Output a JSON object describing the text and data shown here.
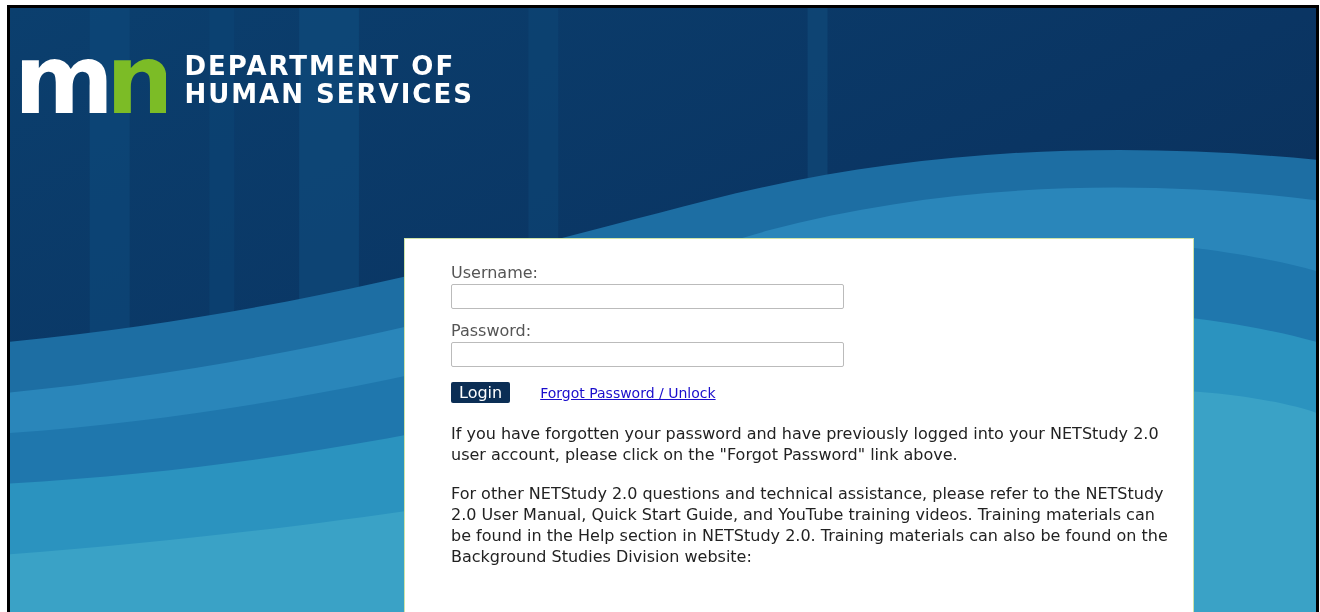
{
  "header": {
    "logo_mark": "mn",
    "title_line_1": "DEPARTMENT OF",
    "title_line_2": "HUMAN SERVICES"
  },
  "login": {
    "username_label": "Username:",
    "password_label": "Password:",
    "login_button": "Login",
    "forgot_link": "Forgot Password / Unlock",
    "paragraphs": [
      "If you have forgotten your password and have previously logged into your NETStudy 2.0 user account, please click on the \"Forgot Password\" link above.",
      "For other NETStudy 2.0 questions and technical assistance, please refer to the NETStudy 2.0 User Manual, Quick Start Guide, and YouTube training videos. Training materials can be found in the Help section in NETStudy 2.0. Training materials can also be found on the Background Studies Division website:"
    ]
  }
}
